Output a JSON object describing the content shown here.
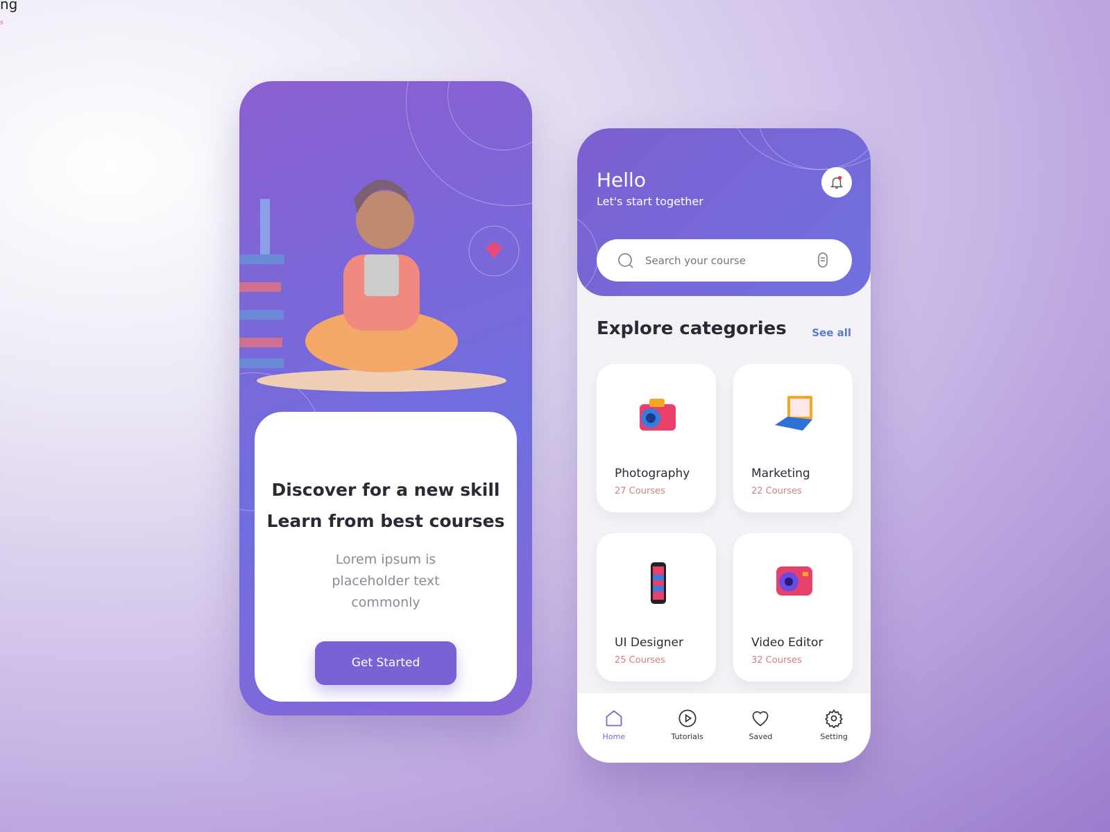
{
  "background_text": {
    "partial_title": "ng",
    "partial_sub": "s"
  },
  "onboarding": {
    "headline_1": "Discover for a new skill",
    "headline_2": "Learn from best courses",
    "description": "Lorem ipsum is placeholder text commonly",
    "cta": "Get Started"
  },
  "home": {
    "greeting": "Hello",
    "subtitle": "Let's start  together",
    "search_placeholder": "Search your course",
    "section_title": "Explore categories",
    "see_all": "See all",
    "categories": [
      {
        "name": "Photography",
        "count": "27 Courses",
        "icon": "camera-icon"
      },
      {
        "name": "Marketing",
        "count": "22 Courses",
        "icon": "laptop-icon"
      },
      {
        "name": "UI Designer",
        "count": "25 Courses",
        "icon": "phone-icon"
      },
      {
        "name": "Video Editor",
        "count": "32 Courses",
        "icon": "video-camera-icon"
      }
    ],
    "nav": [
      {
        "label": "Home",
        "icon": "home-icon",
        "active": true
      },
      {
        "label": "Tutorials",
        "icon": "play-icon"
      },
      {
        "label": "Saved",
        "icon": "heart-icon"
      },
      {
        "label": "Setting",
        "icon": "gear-icon"
      }
    ]
  },
  "colors": {
    "accent": "#7a62d4",
    "link": "#5a7bd0",
    "count": "#d08080"
  }
}
